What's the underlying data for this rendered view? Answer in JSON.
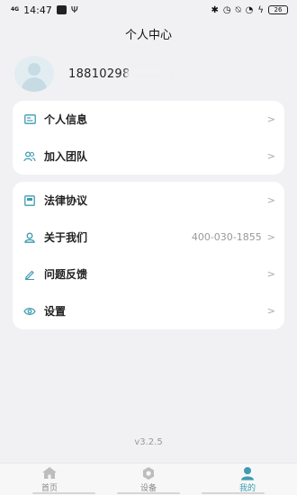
{
  "status_bar": {
    "network": "4G",
    "time": "14:47",
    "battery": "26"
  },
  "header": {
    "title": "个人中心"
  },
  "profile": {
    "phone": "18810298"
  },
  "menu_group_1": [
    {
      "label": "个人信息",
      "icon": "id-card-icon"
    },
    {
      "label": "加入团队",
      "icon": "team-icon"
    }
  ],
  "menu_group_2": [
    {
      "label": "法律协议",
      "icon": "document-icon"
    },
    {
      "label": "关于我们",
      "icon": "user-icon",
      "value": "400-030-1855"
    },
    {
      "label": "问题反馈",
      "icon": "edit-icon"
    },
    {
      "label": "设置",
      "icon": "eye-icon"
    }
  ],
  "version": "v3.2.5",
  "tab_bar": [
    {
      "label": "首页",
      "icon": "home-icon",
      "active": false
    },
    {
      "label": "设备",
      "icon": "device-icon",
      "active": false
    },
    {
      "label": "我的",
      "icon": "profile-icon",
      "active": true
    }
  ],
  "colors": {
    "accent": "#3e9bb2",
    "background": "#f1f1f3",
    "card": "#ffffff"
  }
}
